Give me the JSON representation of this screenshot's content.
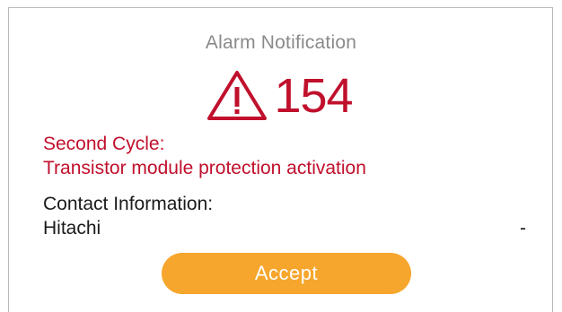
{
  "dialog": {
    "title": "Alarm Notification",
    "alarm_code": "154",
    "alert_color": "#c0102c",
    "icon": "warning-triangle-icon"
  },
  "details": {
    "cycle": "Second Cycle:",
    "message": "Transistor module protection activation",
    "contact_label": "Contact Information:",
    "contact_value": "Hitachi",
    "contact_extra": "-"
  },
  "actions": {
    "accept_label": "Accept",
    "accept_color": "#f6a62c"
  }
}
